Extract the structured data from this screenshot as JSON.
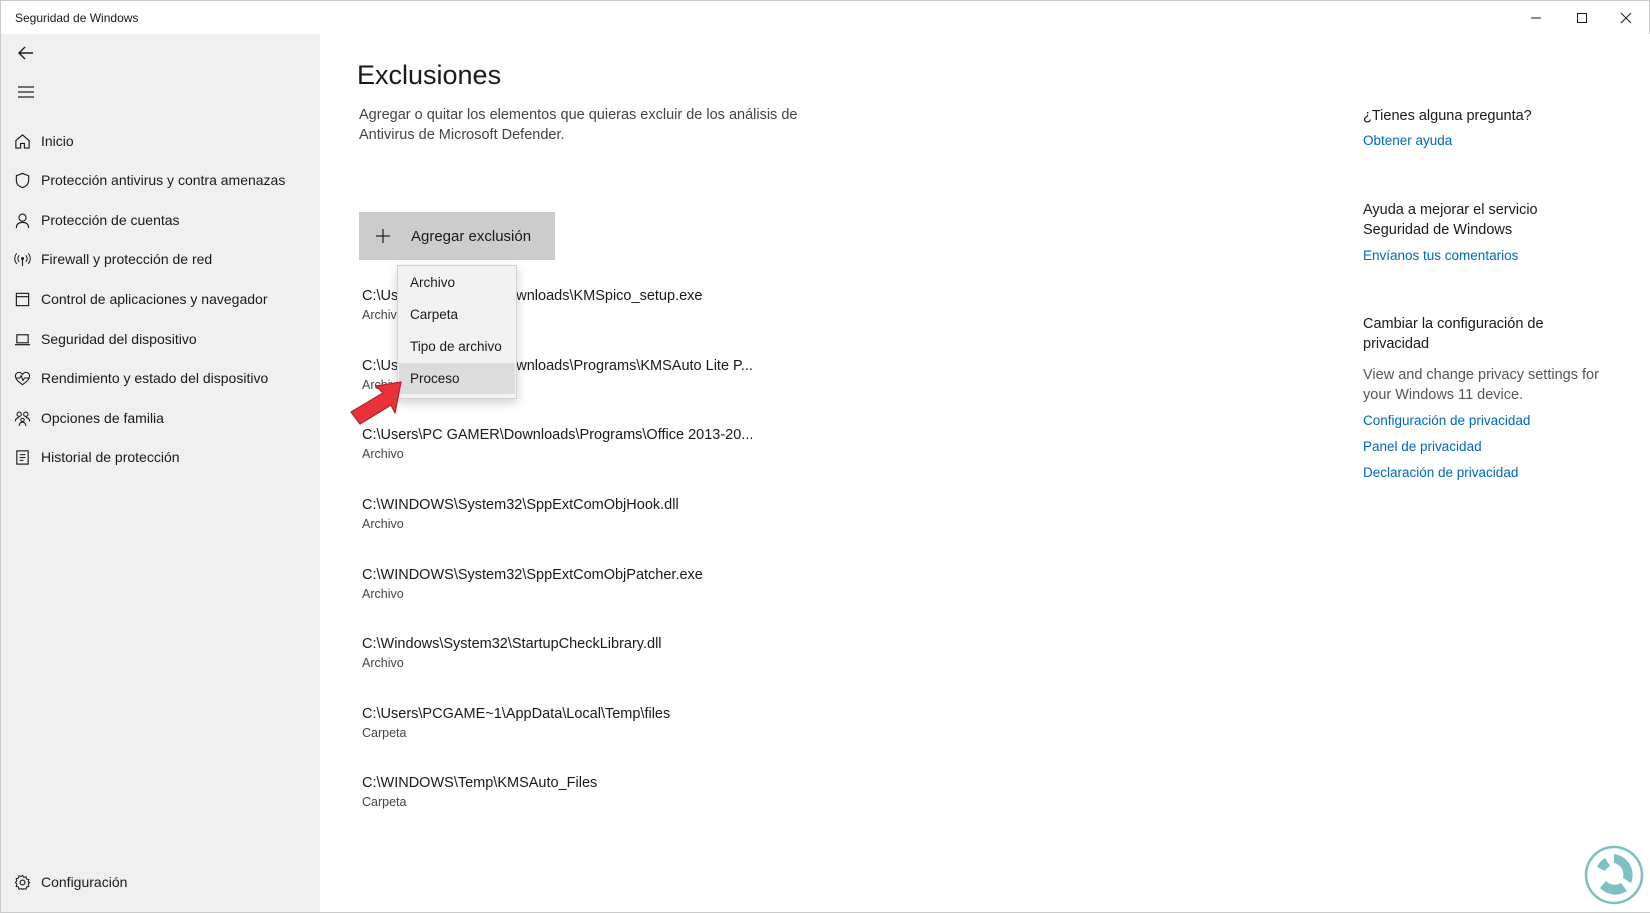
{
  "window": {
    "title": "Seguridad de Windows"
  },
  "sidebar": {
    "items": [
      {
        "label": "Inicio",
        "icon": "home-icon"
      },
      {
        "label": "Protección antivirus y contra amenazas",
        "icon": "shield-icon"
      },
      {
        "label": "Protección de cuentas",
        "icon": "person-icon"
      },
      {
        "label": "Firewall y protección de red",
        "icon": "antenna-icon"
      },
      {
        "label": "Control de aplicaciones y navegador",
        "icon": "app-browser-icon"
      },
      {
        "label": "Seguridad del dispositivo",
        "icon": "laptop-icon"
      },
      {
        "label": "Rendimiento y estado del dispositivo",
        "icon": "heart-pulse-icon"
      },
      {
        "label": "Opciones de familia",
        "icon": "family-icon"
      },
      {
        "label": "Historial de protección",
        "icon": "history-icon"
      }
    ],
    "settings_label": "Configuración"
  },
  "main": {
    "title": "Exclusiones",
    "description": "Agregar o quitar los elementos que quieras excluir de los análisis de Antivirus de Microsoft Defender.",
    "add_button_label": "Agregar exclusión",
    "exclusions": [
      {
        "path": "C:\\Us                  ownloads\\KMSpico_setup.exe",
        "path_visible_left": "C:\\Us",
        "path_visible_right": "wnloads\\KMSpico_setup.exe",
        "type": "Archivo"
      },
      {
        "path_visible_left": "C:\\Us",
        "path_visible_right": "wnloads\\Programs\\KMSAuto Lite P...",
        "type": "Archivo"
      },
      {
        "path": "C:\\Users\\PC GAMER\\Downloads\\Programs\\Office 2013-20...",
        "type": "Archivo"
      },
      {
        "path": "C:\\WINDOWS\\System32\\SppExtComObjHook.dll",
        "type": "Archivo"
      },
      {
        "path": "C:\\WINDOWS\\System32\\SppExtComObjPatcher.exe",
        "type": "Archivo"
      },
      {
        "path": "C:\\Windows\\System32\\StartupCheckLibrary.dll",
        "type": "Archivo"
      },
      {
        "path": "C:\\Users\\PCGAME~1\\AppData\\Local\\Temp\\files",
        "type": "Carpeta"
      },
      {
        "path": "C:\\WINDOWS\\Temp\\KMSAuto_Files",
        "type": "Carpeta"
      }
    ],
    "menu": {
      "items": [
        "Archivo",
        "Carpeta",
        "Tipo de archivo",
        "Proceso"
      ],
      "highlighted": "Proceso"
    }
  },
  "right": {
    "question_heading": "¿Tienes alguna pregunta?",
    "help_link": "Obtener ayuda",
    "improve_heading": "Ayuda a mejorar el servicio Seguridad de Windows",
    "feedback_link": "Envíanos tus comentarios",
    "privacy_heading": "Cambiar la configuración de privacidad",
    "privacy_text": "View and change privacy settings for your Windows 11 device.",
    "privacy_links": [
      "Configuración de privacidad",
      "Panel de privacidad",
      "Declaración de privacidad"
    ]
  },
  "colors": {
    "accent_link": "#0067c0",
    "sidebar_bg": "#f0f0f0",
    "button_bg": "#cccccc",
    "arrow": "#e8333b"
  }
}
